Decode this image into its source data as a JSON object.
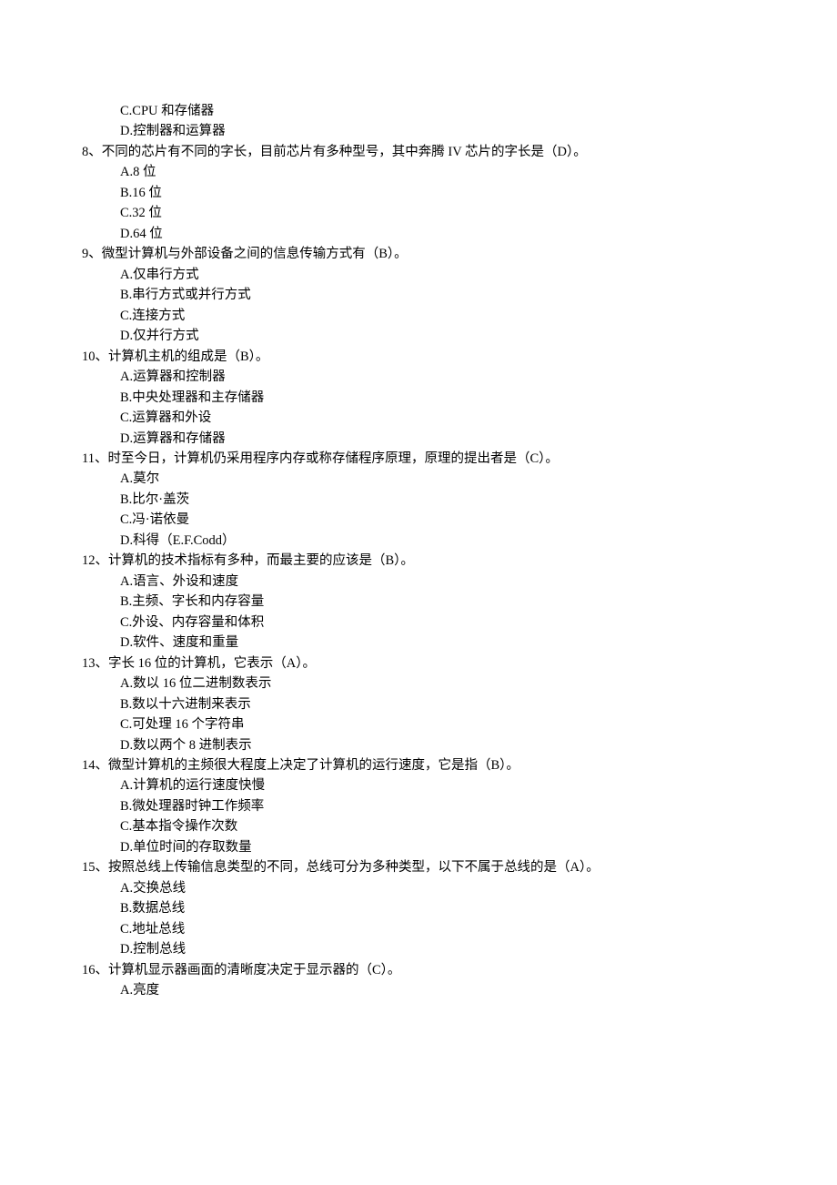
{
  "orphan_options": [
    "C.CPU 和存储器",
    "D.控制器和运算器"
  ],
  "questions": [
    {
      "number": "8、 ",
      "stem": "不同的芯片有不同的字长，目前芯片有多种型号，其中奔腾 IV 芯片的字长是（D）。",
      "options": [
        "A.8 位",
        "B.16 位",
        "C.32 位",
        "D.64 位"
      ]
    },
    {
      "number": "9、 ",
      "stem": "微型计算机与外部设备之间的信息传输方式有（B）。",
      "options": [
        "A.仅串行方式",
        "B.串行方式或并行方式",
        "C.连接方式",
        "D.仅并行方式"
      ]
    },
    {
      "number": "10、",
      "stem": "计算机主机的组成是（B）。",
      "options": [
        "A.运算器和控制器",
        "B.中央处理器和主存储器",
        "C.运算器和外设",
        "D.运算器和存储器"
      ]
    },
    {
      "number": "11、",
      "stem": "时至今日，计算机仍采用程序内存或称存储程序原理，原理的提出者是（C）。",
      "options": [
        "A.莫尔",
        "B.比尔·盖茨",
        "C.冯·诺依曼",
        "D.科得（E.F.Codd）"
      ]
    },
    {
      "number": "12、",
      "stem": "计算机的技术指标有多种，而最主要的应该是（B）。",
      "options": [
        "A.语言、外设和速度",
        "B.主频、字长和内存容量",
        "C.外设、内存容量和体积",
        "D.软件、速度和重量"
      ]
    },
    {
      "number": "13、",
      "stem": "字长 16 位的计算机，它表示（A）。",
      "options": [
        "A.数以 16 位二进制数表示",
        "B.数以十六进制来表示",
        "C.可处理 16 个字符串",
        "D.数以两个 8 进制表示"
      ]
    },
    {
      "number": "14、",
      "stem": "微型计算机的主频很大程度上决定了计算机的运行速度，它是指（B）。",
      "options": [
        "A.计算机的运行速度快慢",
        "B.微处理器时钟工作频率",
        "C.基本指令操作次数",
        "D.单位时间的存取数量"
      ]
    },
    {
      "number": "15、",
      "stem": "按照总线上传输信息类型的不同，总线可分为多种类型，以下不属于总线的是（A）。",
      "options": [
        "A.交换总线",
        "B.数据总线",
        "C.地址总线",
        "D.控制总线"
      ]
    },
    {
      "number": "16、",
      "stem": "计算机显示器画面的清晰度决定于显示器的（C）。",
      "options": [
        "A.亮度"
      ]
    }
  ]
}
